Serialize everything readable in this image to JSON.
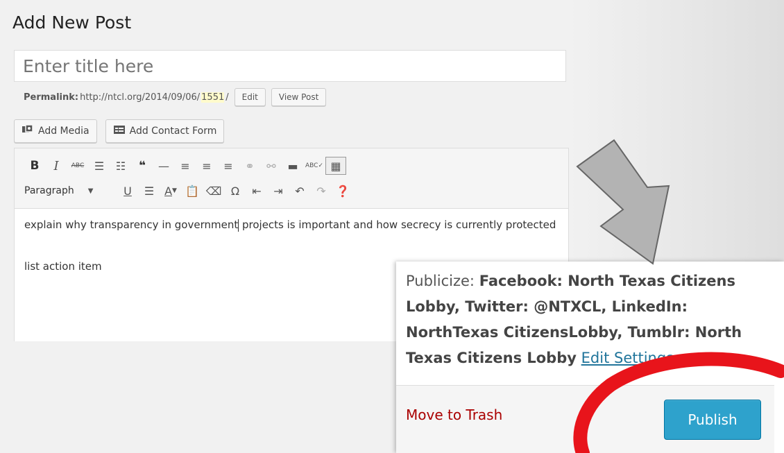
{
  "page": {
    "title": "Add New Post"
  },
  "title_input": {
    "placeholder": "Enter title here",
    "value": ""
  },
  "permalink": {
    "label": "Permalink:",
    "url_base": "http://ntcl.org/2014/09/06/",
    "slug": "1551",
    "trail": "/",
    "edit_label": "Edit",
    "view_label": "View Post"
  },
  "media_buttons": {
    "add_media": "Add Media",
    "add_contact_form": "Add Contact Form"
  },
  "editor": {
    "format_select": "Paragraph",
    "content": [
      {
        "before": "explain why transparency in government",
        "after": " projects is important and how secrecy is currently protected"
      },
      {
        "text": "list action item"
      }
    ]
  },
  "toolbar_icons": {
    "row1": [
      "bold-icon",
      "italic-icon",
      "strikethrough-icon",
      "bullet-list-icon",
      "numbered-list-icon",
      "blockquote-icon",
      "horizontal-rule-icon",
      "align-left-icon",
      "align-center-icon",
      "align-right-icon",
      "link-icon",
      "unlink-icon",
      "read-more-icon",
      "spellcheck-icon",
      "toolbar-toggle-icon"
    ],
    "row2": [
      "underline-icon",
      "justify-icon",
      "text-color-icon",
      "paste-text-icon",
      "clear-formatting-icon",
      "special-character-icon",
      "outdent-icon",
      "indent-icon",
      "undo-icon",
      "redo-icon",
      "help-icon"
    ]
  },
  "publish_box": {
    "publicize_label": "Publicize:",
    "publicize_accounts": "Facebook: North Texas Citizens Lobby, Twitter: @NTXCL, LinkedIn: NorthTexas CitizensLobby, Tumblr: North Texas Citizens Lobby",
    "edit_settings": "Edit Settings",
    "trash_label": "Move to Trash",
    "publish_label": "Publish"
  },
  "annotations": {
    "arrow_color": "#b3b3b3",
    "circle_color": "#e8141b"
  }
}
